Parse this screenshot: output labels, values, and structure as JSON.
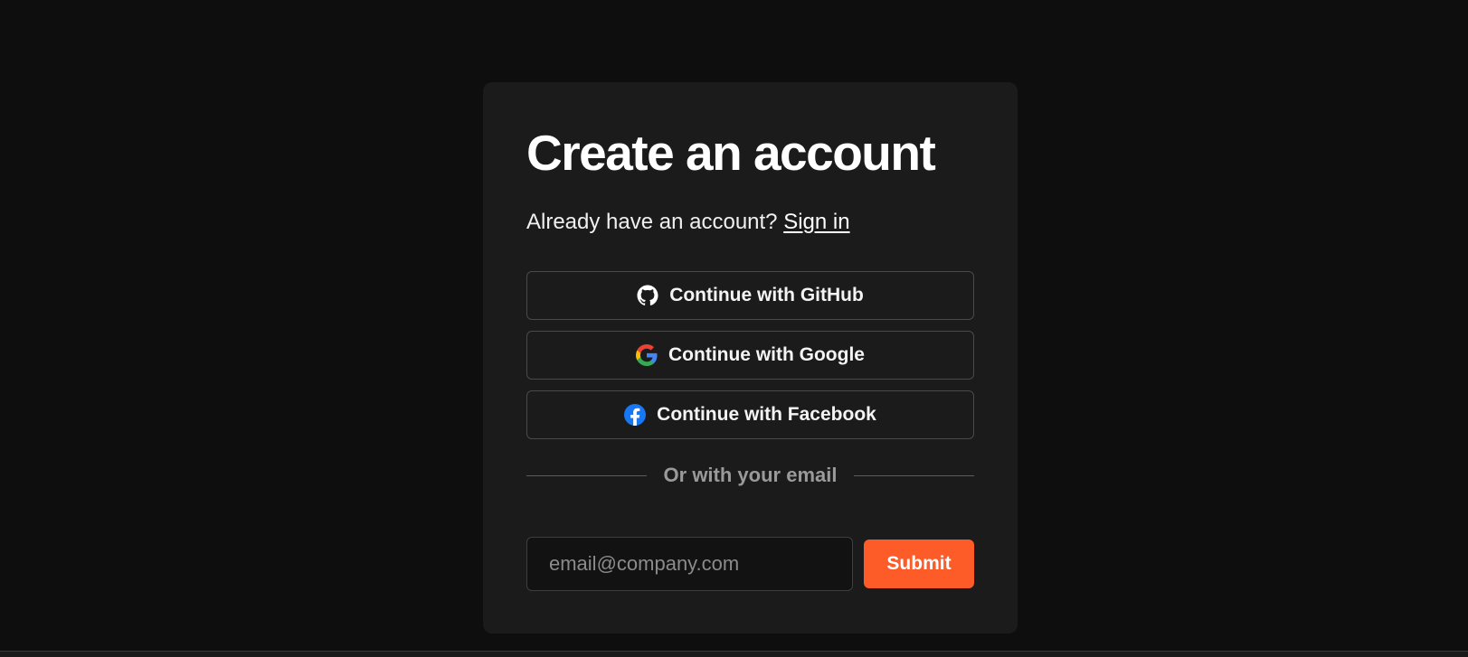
{
  "card": {
    "title": "Create an account",
    "subtitle_prefix": "Already have an account?",
    "sign_in_link": "Sign in"
  },
  "oauth": [
    {
      "provider": "GitHub",
      "label": "Continue with GitHub",
      "icon": "github-icon"
    },
    {
      "provider": "Google",
      "label": "Continue with Google",
      "icon": "google-icon"
    },
    {
      "provider": "Facebook",
      "label": "Continue with Facebook",
      "icon": "facebook-icon"
    }
  ],
  "divider": {
    "label": "Or with your email"
  },
  "email_form": {
    "value": "",
    "placeholder": "email@company.com",
    "submit_label": "Submit"
  },
  "colors": {
    "page_background": "#0e0e0e",
    "card_background": "#1b1b1b",
    "accent": "#fd5b27",
    "facebook_blue": "#1877f2"
  }
}
